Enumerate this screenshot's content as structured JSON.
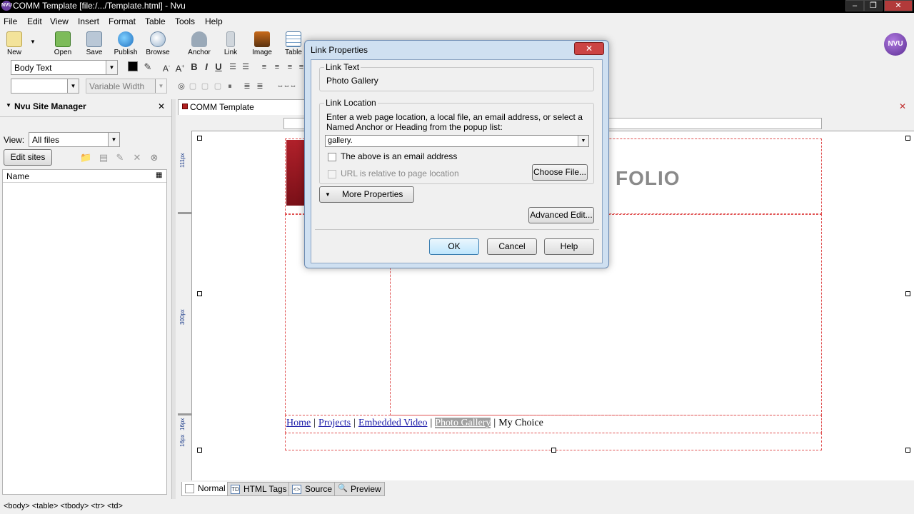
{
  "window": {
    "title": "COMM Template [file:/.../Template.html] - Nvu",
    "app_icon": "NVU",
    "controls": [
      "–",
      "❐",
      "✕"
    ]
  },
  "menu": [
    "File",
    "Edit",
    "View",
    "Insert",
    "Format",
    "Table",
    "Tools",
    "Help"
  ],
  "toolbar": {
    "buttons": [
      {
        "label": "New",
        "icon": "new-icon"
      },
      {
        "label": "Open",
        "icon": "open-icon"
      },
      {
        "label": "Save",
        "icon": "save-icon"
      },
      {
        "label": "Publish",
        "icon": "publish-icon"
      },
      {
        "label": "Browse",
        "icon": "browse-icon"
      },
      {
        "label": "Anchor",
        "icon": "anchor-icon"
      },
      {
        "label": "Link",
        "icon": "link-icon"
      },
      {
        "label": "Image",
        "icon": "image-icon"
      },
      {
        "label": "Table",
        "icon": "table-icon"
      }
    ],
    "brand_logo": "NVU"
  },
  "format_toolbar": {
    "paragraph_style": "Body Text",
    "width_mode": "Variable Width",
    "bold": "B",
    "italic": "I",
    "underline": "U"
  },
  "sidebar": {
    "title": "Nvu Site Manager",
    "close_glyph": "✕",
    "view_label": "View:",
    "view_value": "All files",
    "edit_sites_label": "Edit sites",
    "column_name": "Name"
  },
  "editor": {
    "tab_title": "COMM Template",
    "ruler_marks": [
      "111px",
      "300px",
      "16px",
      "16px"
    ],
    "banner_text": "FOLIO",
    "nav_links": [
      {
        "label": "Home"
      },
      {
        "label": "Projects"
      },
      {
        "label": "Embedded Video"
      },
      {
        "label": "Photo Gallery",
        "selected": true
      },
      {
        "label": "My Choice",
        "plain": true
      }
    ],
    "separator": "|"
  },
  "bottom_tabs": [
    "Normal",
    "HTML Tags",
    "Source",
    "Preview"
  ],
  "status_path": "<body> <table> <tbody> <tr> <td>",
  "dialog": {
    "title": "Link Properties",
    "link_text_group": "Link Text",
    "link_text_value": "Photo Gallery",
    "link_location_group": "Link Location",
    "instructions": "Enter a web page location, a local file, an email address, or select a Named Anchor or Heading from the popup list:",
    "location_value": "gallery.",
    "email_checkbox_label": "The above is an email address",
    "relative_checkbox_label": "URL is relative to page location",
    "choose_file_label": "Choose File...",
    "more_properties_label": "More Properties",
    "advanced_edit_label": "Advanced Edit...",
    "ok_label": "OK",
    "cancel_label": "Cancel",
    "help_label": "Help"
  },
  "colors": {
    "dialog_frame": "#cfe0f1",
    "link": "#1a1aa8",
    "dashed_border": "#e05050",
    "close_button": "#cc4444"
  }
}
